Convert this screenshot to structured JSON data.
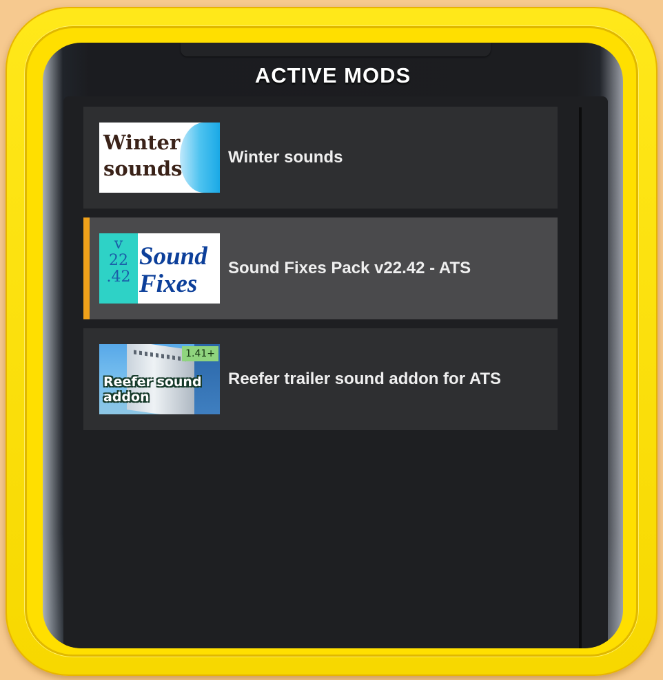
{
  "panel": {
    "title": "ACTIVE MODS"
  },
  "colors": {
    "frame": "#ffdf00",
    "background": "#f6c98f",
    "selected_accent": "#f0a11a"
  },
  "mods": [
    {
      "name": "Winter sounds",
      "selected": false,
      "thumb_text": [
        "Winter",
        "sounds"
      ]
    },
    {
      "name": "Sound Fixes Pack v22.42 - ATS",
      "selected": true,
      "thumb_version": [
        "v",
        "22",
        ".42"
      ],
      "thumb_text": [
        "Sound",
        "Fixes"
      ]
    },
    {
      "name": "Reefer trailer sound addon for ATS",
      "selected": false,
      "thumb_badge": "1.41+",
      "thumb_text": [
        "Reefer sound",
        "addon"
      ]
    }
  ]
}
